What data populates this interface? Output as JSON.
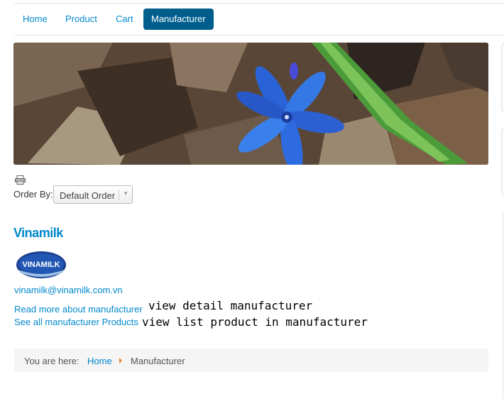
{
  "nav": {
    "items": [
      {
        "label": "Home"
      },
      {
        "label": "Product"
      },
      {
        "label": "Cart"
      },
      {
        "label": "Manufacturer",
        "active": true
      }
    ]
  },
  "hero": {
    "subject": "blue flower on dry leaves"
  },
  "print": {
    "icon": "printer-icon"
  },
  "order": {
    "label": "Order By:",
    "selected": "Default Order"
  },
  "manufacturer": {
    "name": "Vinamilk",
    "logo_text": "VINAMILK",
    "email": "vinamilk@vinamilk.com.vn",
    "read_more": "Read more about manufacturer",
    "see_all": "See all manufacturer Products"
  },
  "annotations": {
    "detail": "view detail manufacturer",
    "list": "view list product in manufacturer"
  },
  "breadcrumb": {
    "prefix": "You are here:",
    "home": "Home",
    "current": "Manufacturer"
  },
  "colors": {
    "link": "#0088cc",
    "active_tab": "#005e8d",
    "breadcrumb_sep": "#e08a2c",
    "logo_blue": "#1a3f8f"
  }
}
